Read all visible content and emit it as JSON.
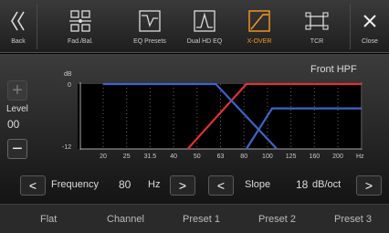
{
  "toolbar": {
    "items": [
      {
        "label": "Back",
        "icon": "double-chevron-left-icon"
      },
      {
        "label": "Fad./Bal.",
        "icon": "fader-balance-icon"
      },
      {
        "label": "EQ Presets",
        "icon": "eq-presets-icon"
      },
      {
        "label": "Dual HD EQ",
        "icon": "dual-hd-eq-icon"
      },
      {
        "label": "X-OVER",
        "icon": "crossover-icon",
        "active": true
      },
      {
        "label": "TCR",
        "icon": "tcr-icon"
      },
      {
        "label": "Close",
        "icon": "close-icon"
      }
    ]
  },
  "level": {
    "label": "Level",
    "value": "00",
    "plus": "+",
    "minus": "−"
  },
  "graph": {
    "title": "Front HPF",
    "y_unit": "dB",
    "y_top": "0",
    "y_bottom": "-12",
    "x_ticks": [
      "20",
      "25",
      "31.5",
      "40",
      "50",
      "63",
      "80",
      "100",
      "125",
      "160",
      "200"
    ],
    "x_unit": "Hz"
  },
  "chart_data": {
    "type": "line",
    "ylim": [
      -12,
      0
    ],
    "x_categories": [
      "20",
      "25",
      "31.5",
      "40",
      "50",
      "63",
      "80",
      "100",
      "125",
      "160",
      "200"
    ],
    "series": [
      {
        "color": "#e03030",
        "points": [
          [
            3.6,
            -12
          ],
          [
            6.1,
            0
          ],
          [
            11,
            0
          ]
        ]
      },
      {
        "color": "#3a66c8",
        "points": [
          [
            0,
            0
          ],
          [
            4.8,
            0
          ],
          [
            7.4,
            -12
          ]
        ]
      },
      {
        "color": "#3a66c8",
        "points": [
          [
            6.1,
            -12
          ],
          [
            7.2,
            -4.5
          ],
          [
            11,
            -4.5
          ]
        ]
      }
    ]
  },
  "controls": {
    "frequency_label": "Frequency",
    "frequency_value": "80",
    "frequency_unit": "Hz",
    "slope_label": "Slope",
    "slope_value": "18",
    "slope_unit": "dB/oct",
    "prev": "<",
    "next": ">"
  },
  "bottom_tabs": [
    "Flat",
    "Channel",
    "Preset 1",
    "Preset 2",
    "Preset 3"
  ],
  "colors": {
    "accent": "#ff9a20",
    "hpf_red": "#e03030",
    "blue": "#3a66c8"
  }
}
